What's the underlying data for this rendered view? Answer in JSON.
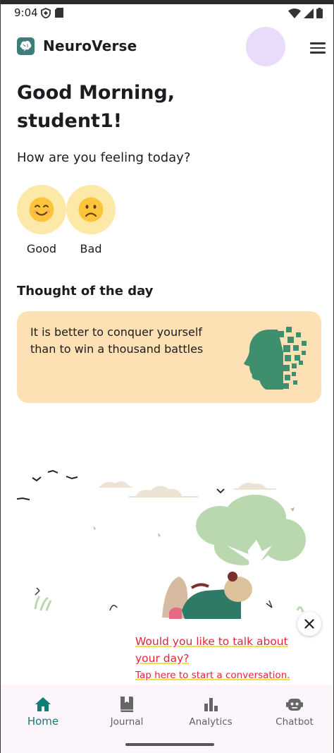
{
  "status_bar": {
    "time": "9:04"
  },
  "app": {
    "title": "NeuroVerse"
  },
  "greeting": {
    "line1": "Good Morning,",
    "line2": "student1!"
  },
  "mood": {
    "question": "How are you feeling today?",
    "options": [
      {
        "emoji": "😊",
        "label": "Good"
      },
      {
        "emoji": "☹️",
        "label": "Bad"
      }
    ]
  },
  "thought": {
    "heading": "Thought of the day",
    "quote": "It is better to conquer yourself than to win a thousand battles"
  },
  "chat_prompt": {
    "title": "Would you like to talk about your day?",
    "action": "Tap here to start a conversation."
  },
  "bottom_nav": {
    "items": [
      {
        "label": "Home",
        "icon": "home-icon",
        "active": true
      },
      {
        "label": "Journal",
        "icon": "journal-icon",
        "active": false
      },
      {
        "label": "Analytics",
        "icon": "analytics-icon",
        "active": false
      },
      {
        "label": "Chatbot",
        "icon": "chatbot-icon",
        "active": false
      }
    ]
  },
  "colors": {
    "accent": "#0f7f73",
    "mood_circle": "#fde9a7",
    "thought_card": "#fde0b3",
    "prompt_text": "#e0243a",
    "avatar": "#e9dcfb",
    "nav_background": "#fcf5fc"
  }
}
